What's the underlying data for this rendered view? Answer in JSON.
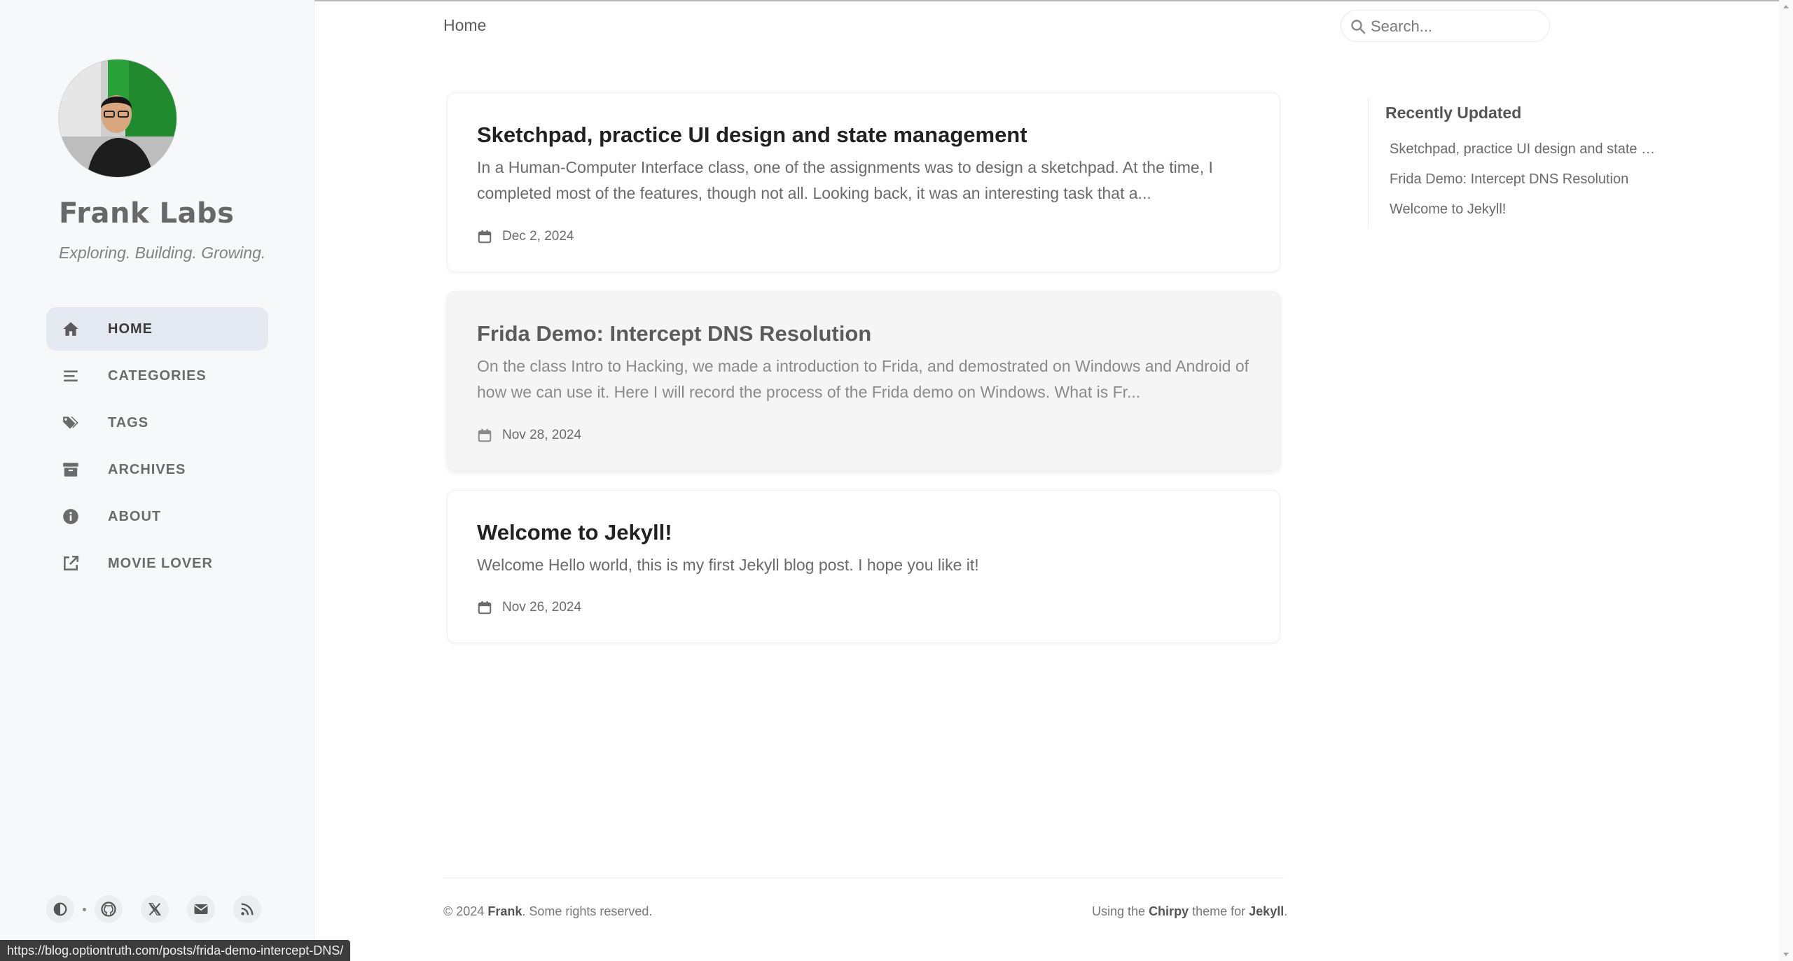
{
  "sidebar": {
    "site_title": "Frank Labs",
    "site_subtitle": "Exploring. Building. Growing.",
    "nav": [
      {
        "label": "HOME",
        "icon": "home-icon",
        "active": true
      },
      {
        "label": "CATEGORIES",
        "icon": "stream-icon"
      },
      {
        "label": "TAGS",
        "icon": "tags-icon"
      },
      {
        "label": "ARCHIVES",
        "icon": "archive-icon"
      },
      {
        "label": "ABOUT",
        "icon": "info-circle-icon"
      },
      {
        "label": "MOVIE LOVER",
        "icon": "external-link-icon"
      }
    ],
    "bottom_icons": [
      "theme-toggle-icon",
      "github-icon",
      "x-twitter-icon",
      "email-icon",
      "rss-icon"
    ]
  },
  "topbar": {
    "breadcrumb": "Home",
    "search_placeholder": "Search..."
  },
  "posts": [
    {
      "title": "Sketchpad, practice UI design and state management",
      "excerpt": "In a Human-Computer Interface class, one of the assignments was to design a sketchpad. At the time, I completed most of the features, though not all. Looking back, it was an interesting task that a...",
      "date": "Dec 2, 2024"
    },
    {
      "title": "Frida Demo: Intercept DNS Resolution",
      "excerpt": "On the class Intro to Hacking, we made a introduction to Frida, and demostrated on Windows and Android of how we can use it. Here I will record the process of the Frida demo on Windows. What is Fr...",
      "date": "Nov 28, 2024"
    },
    {
      "title": "Welcome to Jekyll!",
      "excerpt": "Welcome Hello world, this is my first Jekyll blog post. I hope you like it!",
      "date": "Nov 26, 2024"
    }
  ],
  "recently_updated": {
    "heading": "Recently Updated",
    "items": [
      "Sketchpad, practice UI design and state …",
      "Frida Demo: Intercept DNS Resolution",
      "Welcome to Jekyll!"
    ]
  },
  "footer": {
    "copyright_prefix": "© 2024",
    "author": "Frank",
    "rights": ". Some rights reserved.",
    "using": "Using the",
    "theme": "Chirpy",
    "theme_for": "theme for",
    "engine": "Jekyll",
    "period": "."
  },
  "status_bar": {
    "url": "https://blog.optiontruth.com/posts/frida-demo-intercept-DNS/"
  },
  "colors": {
    "sidebar_bg": "#f6f8fa",
    "active_nav_bg": "#e5eaf2",
    "hover_card_bg": "#f5f5f5"
  }
}
